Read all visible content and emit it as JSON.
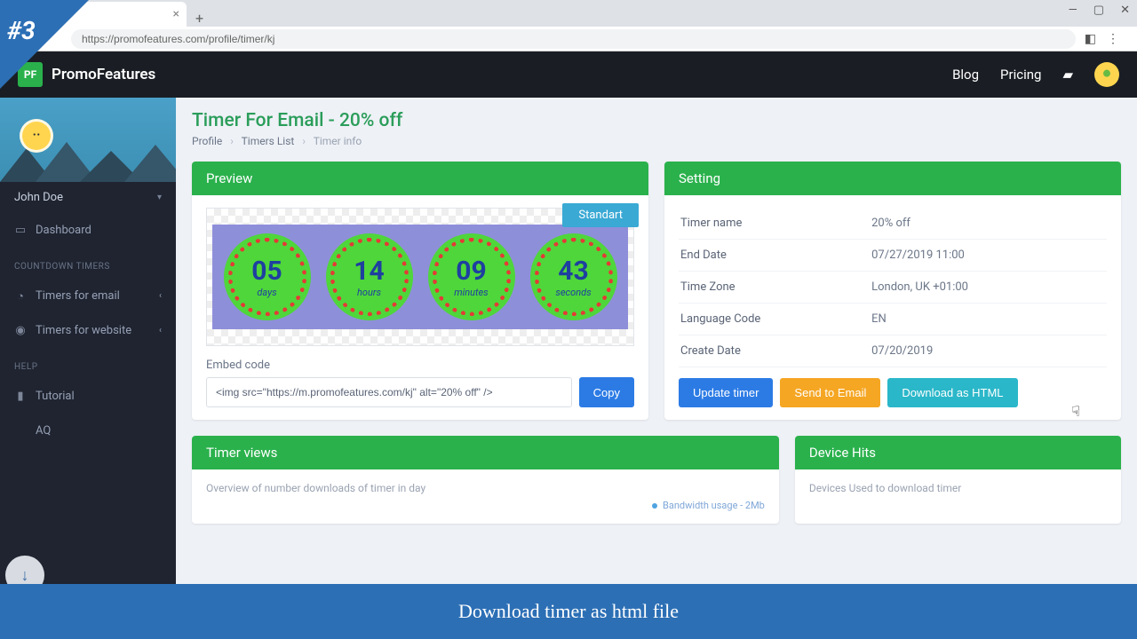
{
  "badge": "#3",
  "browser": {
    "tab_close": "×",
    "new_tab": "+",
    "url": "https://promofeatures.com/profile/timer/kj",
    "win_min": "—",
    "win_max": "▢",
    "win_close": "✕"
  },
  "header": {
    "logo_sq": "PF",
    "brand": "PromoFeatures",
    "blog": "Blog",
    "pricing": "Pricing"
  },
  "sidebar": {
    "user": "John Doe",
    "dashboard": "Dashboard",
    "section_timers": "COUNTDOWN TIMERS",
    "timers_email": "Timers for email",
    "timers_website": "Timers for website",
    "section_help": "HELP",
    "tutorial": "Tutorial",
    "faq": "AQ"
  },
  "page": {
    "title": "Timer For Email - 20% off",
    "bc_profile": "Profile",
    "bc_list": "Timers List",
    "bc_info": "Timer info"
  },
  "preview": {
    "head": "Preview",
    "badge": "Standart",
    "dials": [
      {
        "num": "05",
        "lbl": "days"
      },
      {
        "num": "14",
        "lbl": "hours"
      },
      {
        "num": "09",
        "lbl": "minutes"
      },
      {
        "num": "43",
        "lbl": "seconds"
      }
    ],
    "embed_label": "Embed code",
    "embed_value": "<img src=\"https://m.promofeatures.com/kj\" alt=\"20% off\" />",
    "copy": "Copy"
  },
  "setting": {
    "head": "Setting",
    "rows": [
      {
        "lbl": "Timer name",
        "val": "20% off"
      },
      {
        "lbl": "End Date",
        "val": "07/27/2019 11:00"
      },
      {
        "lbl": "Time Zone",
        "val": "London, UK +01:00"
      },
      {
        "lbl": "Language Code",
        "val": "EN"
      },
      {
        "lbl": "Create Date",
        "val": "07/20/2019"
      }
    ],
    "update": "Update timer",
    "send": "Send to Email",
    "download": "Download as HTML"
  },
  "views": {
    "head": "Timer views",
    "sub": "Overview of number downloads of timer in day",
    "bw": "Bandwidth usage - 2Mb"
  },
  "devices": {
    "head": "Device Hits",
    "sub": "Devices Used to download timer"
  },
  "caption": "Download timer as html file"
}
